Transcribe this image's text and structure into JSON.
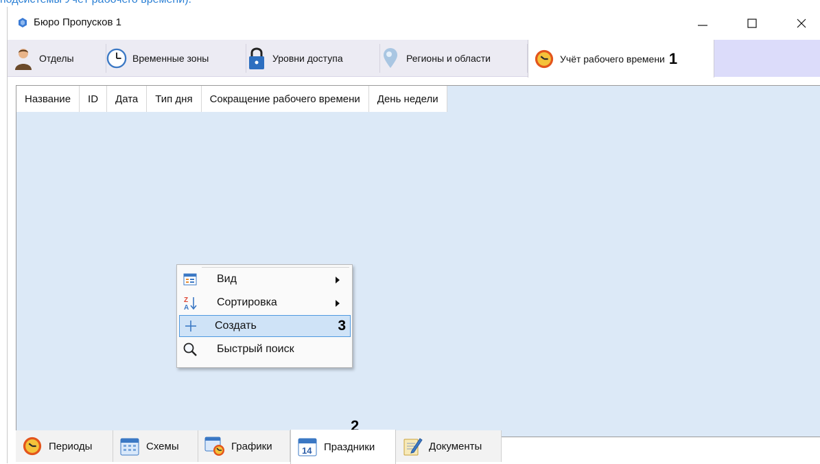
{
  "doc_link": "подсистемы Учёт рабочего времени).",
  "window": {
    "title": "Бюро Пропусков 1",
    "controls": {
      "minimize": "—",
      "maximize": "☐",
      "close": "✕"
    }
  },
  "top_tabs": [
    {
      "label": "Отделы",
      "icon": "person-icon"
    },
    {
      "label": "Временные зоны",
      "icon": "clock-icon"
    },
    {
      "label": "Уровни доступа",
      "icon": "lock-icon"
    },
    {
      "label": "Регионы и области",
      "icon": "map-pin-icon"
    },
    {
      "label": "Учёт рабочего времени",
      "icon": "timer-icon",
      "active": true,
      "callout": "1"
    }
  ],
  "table": {
    "columns": [
      "Название",
      "ID",
      "Дата",
      "Тип дня",
      "Сокращение рабочего времени",
      "День недели"
    ]
  },
  "context_menu": {
    "items": [
      {
        "label": "Вид",
        "icon": "view-list-icon",
        "submenu": true
      },
      {
        "label": "Сортировка",
        "icon": "sort-az-icon",
        "submenu": true
      },
      {
        "label": "Создать",
        "icon": "plus-icon",
        "highlighted": true,
        "callout": "3"
      },
      {
        "label": "Быстрый поиск",
        "icon": "search-icon"
      }
    ]
  },
  "bottom_tabs": [
    {
      "label": "Периоды",
      "icon": "timer-icon"
    },
    {
      "label": "Схемы",
      "icon": "calendar-icon"
    },
    {
      "label": "Графики",
      "icon": "calendar-clock-icon"
    },
    {
      "label": "Праздники",
      "icon": "calendar-day-icon",
      "active": true,
      "day": "14"
    },
    {
      "label": "Документы",
      "icon": "document-edit-icon"
    }
  ],
  "callouts": {
    "bottom_tab": "2"
  },
  "colors": {
    "content_bg": "#dce9f7",
    "tabbar_bg": "#ecebf3",
    "tab_accent": "#dcdcfa",
    "menu_highlight": "#cfe3f7",
    "menu_highlight_border": "#4d98e0"
  }
}
